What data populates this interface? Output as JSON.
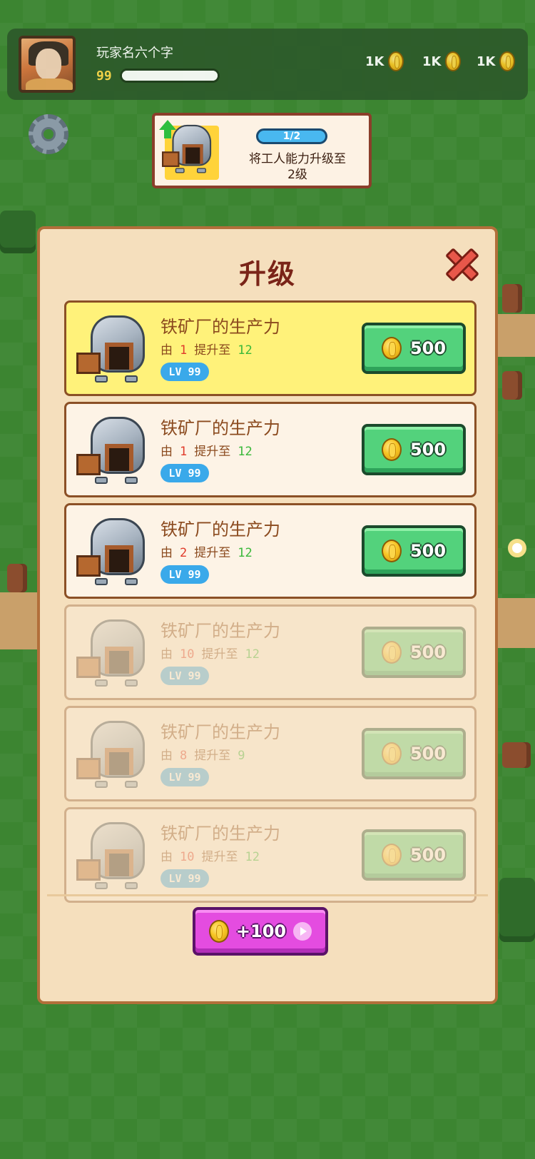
{
  "player": {
    "name": "玩家名六个字",
    "level": "99"
  },
  "currencies": [
    {
      "amount": "1K",
      "icon": "coin-icon"
    },
    {
      "amount": "1K",
      "icon": "coin-icon"
    },
    {
      "amount": "1K",
      "icon": "coin-icon"
    }
  ],
  "task": {
    "progress": "1/2",
    "description": "将工人能力升级至\n2级"
  },
  "panel": {
    "title": "升级",
    "rows": [
      {
        "title": "铁矿厂的生产力",
        "from_label": "由",
        "from": "1",
        "to_label": "提升至",
        "to": "12",
        "level": "LV 99",
        "price": "500",
        "state": "highlight"
      },
      {
        "title": "铁矿厂的生产力",
        "from_label": "由",
        "from": "1",
        "to_label": "提升至",
        "to": "12",
        "level": "LV 99",
        "price": "500",
        "state": "normal"
      },
      {
        "title": "铁矿厂的生产力",
        "from_label": "由",
        "from": "2",
        "to_label": "提升至",
        "to": "12",
        "level": "LV 99",
        "price": "500",
        "state": "normal"
      },
      {
        "title": "铁矿厂的生产力",
        "from_label": "由",
        "from": "10",
        "to_label": "提升至",
        "to": "12",
        "level": "LV 99",
        "price": "500",
        "state": "locked"
      },
      {
        "title": "铁矿厂的生产力",
        "from_label": "由",
        "from": "8",
        "to_label": "提升至",
        "to": "9",
        "level": "LV 99",
        "price": "500",
        "state": "locked"
      },
      {
        "title": "铁矿厂的生产力",
        "from_label": "由",
        "from": "10",
        "to_label": "提升至",
        "to": "12",
        "level": "LV 99",
        "price": "500",
        "state": "locked"
      }
    ],
    "bonus_button": "+100"
  },
  "colors": {
    "highlight_row": "#fff27a",
    "buy_button": "#53d27c",
    "bonus_button": "#e44ce0",
    "title": "#7a2418"
  }
}
